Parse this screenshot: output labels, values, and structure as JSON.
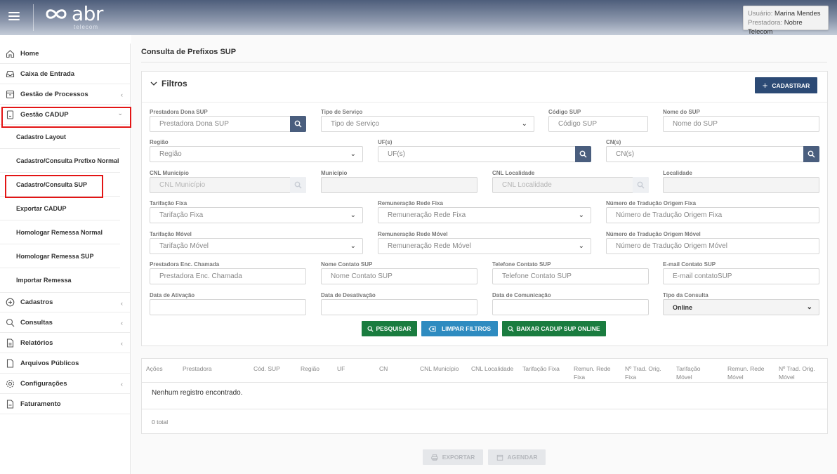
{
  "header": {
    "brand": "abr",
    "brand_sub": "telecom",
    "user_label": "Usuário:",
    "user_name": "Marina Mendes",
    "company_label": "Prestadora:",
    "company_name": "Nobre Telecom"
  },
  "sidebar": {
    "items": [
      {
        "label": "Home",
        "icon": "home-icon"
      },
      {
        "label": "Caixa de Entrada",
        "icon": "inbox-icon"
      },
      {
        "label": "Gestão de Processos",
        "icon": "archive-icon",
        "chevron": "‹"
      },
      {
        "label": "Gestão CADUP",
        "icon": "document-icon",
        "chevron": "⌄"
      }
    ],
    "sub_items": [
      "Cadastro Layout",
      "Cadastro/Consulta Prefixo Normal",
      "Cadastro/Consulta SUP",
      "Exportar CADUP",
      "Homologar Remessa Normal",
      "Homologar Remessa SUP",
      "Importar Remessa"
    ],
    "bottom_items": [
      {
        "label": "Cadastros",
        "icon": "plus-circle-icon",
        "chevron": "‹"
      },
      {
        "label": "Consultas",
        "icon": "search-icon",
        "chevron": "‹"
      },
      {
        "label": "Relatórios",
        "icon": "report-icon",
        "chevron": "‹"
      },
      {
        "label": "Arquivos Públicos",
        "icon": "file-icon"
      },
      {
        "label": "Configurações",
        "icon": "gear-icon",
        "chevron": "‹"
      },
      {
        "label": "Faturamento",
        "icon": "invoice-icon"
      }
    ]
  },
  "page": {
    "title": "Consulta de Prefixos SUP",
    "filters_title": "Filtros",
    "cadastrar_label": "CADASTRAR"
  },
  "filters": {
    "prestadora_dona": {
      "label": "Prestadora Dona SUP",
      "placeholder": "Prestadora Dona SUP"
    },
    "tipo_servico": {
      "label": "Tipo de Serviço",
      "placeholder": "Tipo de Serviço"
    },
    "codigo_sup": {
      "label": "Código SUP",
      "placeholder": "Código SUP"
    },
    "nome_sup": {
      "label": "Nome do SUP",
      "placeholder": "Nome do SUP"
    },
    "regiao": {
      "label": "Região",
      "placeholder": "Região"
    },
    "ufs": {
      "label": "UF(s)",
      "placeholder": "UF(s)"
    },
    "cns": {
      "label": "CN(s)",
      "placeholder": "CN(s)"
    },
    "cnl_municipio": {
      "label": "CNL Município",
      "placeholder": "CNL Município"
    },
    "municipio": {
      "label": "Município",
      "placeholder": ""
    },
    "cnl_localidade": {
      "label": "CNL Localidade",
      "placeholder": "CNL Localidade"
    },
    "localidade": {
      "label": "Localidade",
      "placeholder": ""
    },
    "tarifacao_fixa": {
      "label": "Tarifação Fixa",
      "placeholder": "Tarifação Fixa"
    },
    "remuneracao_fixa": {
      "label": "Remuneração Rede Fixa",
      "placeholder": "Remuneração Rede Fixa"
    },
    "num_trad_fixa": {
      "label": "Número de Tradução Origem Fixa",
      "placeholder": "Número de Tradução Origem Fixa"
    },
    "tarifacao_movel": {
      "label": "Tarifação Móvel",
      "placeholder": "Tarifação Móvel"
    },
    "remuneracao_movel": {
      "label": "Remuneração Rede Móvel",
      "placeholder": "Remuneração Rede Móvel"
    },
    "num_trad_movel": {
      "label": "Número de Tradução Origem Móvel",
      "placeholder": "Número de Tradução Origem Móvel"
    },
    "prestadora_enc": {
      "label": "Prestadora Enc. Chamada",
      "placeholder": "Prestadora Enc. Chamada"
    },
    "nome_contato": {
      "label": "Nome Contato SUP",
      "placeholder": "Nome Contato SUP"
    },
    "telefone_contato": {
      "label": "Telefone Contato SUP",
      "placeholder": "Telefone Contato SUP"
    },
    "email_contato": {
      "label": "E-mail Contato SUP",
      "placeholder": "E-mail contatoSUP"
    },
    "data_ativacao": {
      "label": "Data de Ativação",
      "placeholder": ""
    },
    "data_desativacao": {
      "label": "Data de Desativação",
      "placeholder": ""
    },
    "data_comunicacao": {
      "label": "Data de Comunicação",
      "placeholder": ""
    },
    "tipo_consulta": {
      "label": "Tipo da Consulta",
      "value": "Online"
    }
  },
  "actions": {
    "pesquisar": "PESQUISAR",
    "limpar": "LIMPAR FILTROS",
    "baixar": "BAIXAR CADUP SUP ONLINE"
  },
  "table": {
    "columns": [
      {
        "l1": "Ações",
        "l2": ""
      },
      {
        "l1": "Prestadora",
        "l2": ""
      },
      {
        "l1": "Cód. SUP",
        "l2": ""
      },
      {
        "l1": "Região",
        "l2": ""
      },
      {
        "l1": "UF",
        "l2": ""
      },
      {
        "l1": "CN",
        "l2": ""
      },
      {
        "l1": "CNL Município",
        "l2": ""
      },
      {
        "l1": "CNL Localidade",
        "l2": ""
      },
      {
        "l1": "Tarifação Fixa",
        "l2": ""
      },
      {
        "l1": "Remun. Rede",
        "l2": "Fixa"
      },
      {
        "l1": "Nº Trad. Orig.",
        "l2": "Fixa"
      },
      {
        "l1": "Tarifação",
        "l2": "Móvel"
      },
      {
        "l1": "Remun. Rede",
        "l2": "Móvel"
      },
      {
        "l1": "Nº Trad. Orig.",
        "l2": "Móvel"
      }
    ],
    "empty_text": "Nenhum registro encontrado.",
    "total_text": "0 total"
  },
  "footer": {
    "exportar": "EXPORTAR",
    "agendar": "AGENDAR"
  },
  "colors": {
    "primary": "#2c4a75",
    "green": "#1a7c3f",
    "blue": "#2e8bc0",
    "highlight": "#e31515"
  }
}
